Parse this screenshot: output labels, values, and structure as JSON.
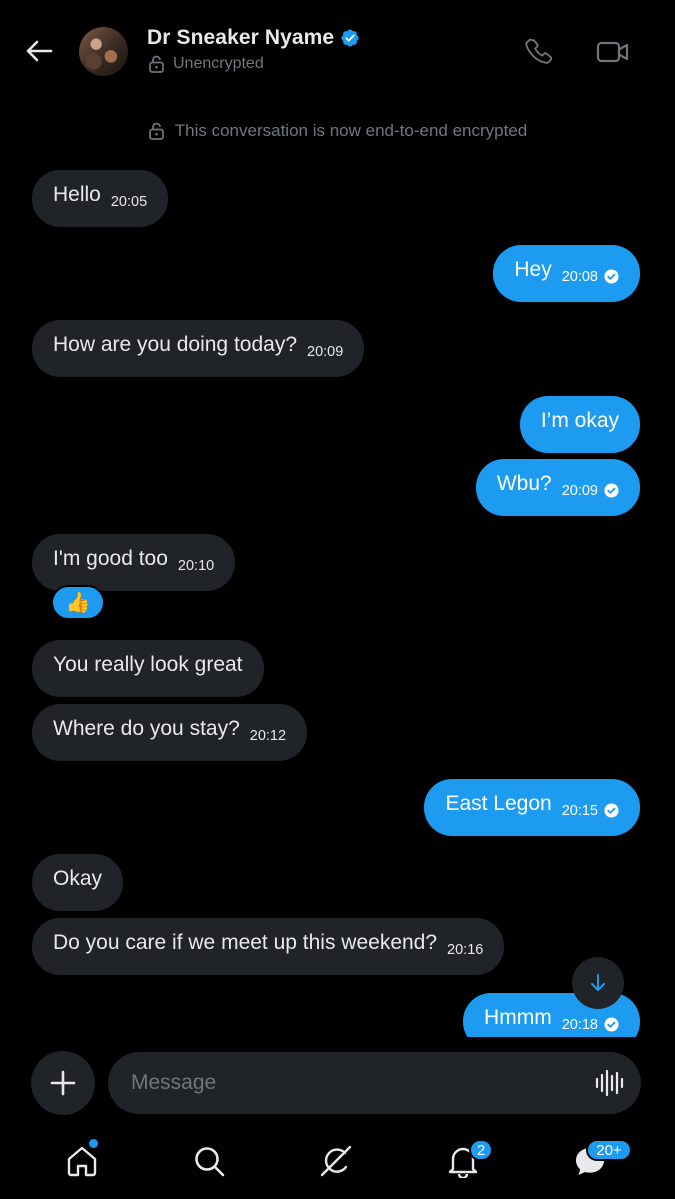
{
  "header": {
    "contact_name": "Dr Sneaker Nyame",
    "status": "Unencrypted"
  },
  "notice": "This conversation is now end-to-end encrypted",
  "messages": [
    {
      "dir": "in",
      "text": "Hello",
      "time": "20:05"
    },
    {
      "dir": "out",
      "text": "Hey",
      "time": "20:08",
      "seen": true
    },
    {
      "dir": "in",
      "text": "How are you doing today?",
      "time": "20:09"
    },
    {
      "dir": "out",
      "text": "I’m okay"
    },
    {
      "dir": "out",
      "text": "Wbu?",
      "time": "20:09",
      "seen": true
    },
    {
      "dir": "in",
      "text": "I'm good too",
      "time": "20:10",
      "reaction": "👍"
    },
    {
      "dir": "in",
      "text": "You really look great"
    },
    {
      "dir": "in",
      "text": "Where do you stay?",
      "time": "20:12"
    },
    {
      "dir": "out",
      "text": "East Legon",
      "time": "20:15",
      "seen": true
    },
    {
      "dir": "in",
      "text": "Okay"
    },
    {
      "dir": "in",
      "text": "Do you care if we meet up this weekend?",
      "time": "20:16"
    },
    {
      "dir": "out",
      "text": "Hmmm",
      "time": "20:18",
      "seen": true
    }
  ],
  "composer": {
    "placeholder": "Message"
  },
  "nav": {
    "notifications_badge": "2",
    "messages_badge": "20+"
  },
  "colors": {
    "accent": "#1d9bf0",
    "incoming_bubble": "#202327",
    "background": "#000000",
    "muted_text": "#71767b"
  },
  "icons": [
    "back-arrow-icon",
    "verified-badge-icon",
    "lock-icon",
    "phone-icon",
    "video-camera-icon",
    "plus-icon",
    "voice-waveform-icon",
    "arrow-down-icon",
    "home-icon",
    "search-icon",
    "grok-icon",
    "bell-icon",
    "messages-icon",
    "check-circle-icon"
  ]
}
